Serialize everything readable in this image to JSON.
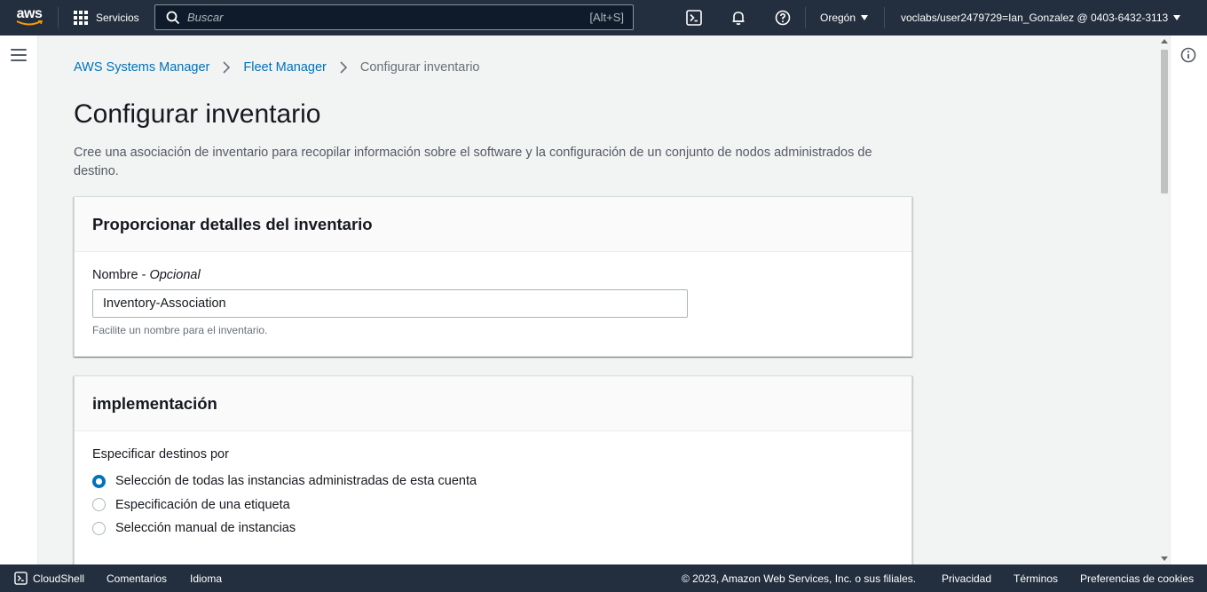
{
  "topnav": {
    "logo_text": "aws",
    "services_label": "Servicios",
    "search_placeholder": "Buscar",
    "search_shortcut": "[Alt+S]",
    "region": "Oregón",
    "account": "voclabs/user2479729=Ian_Gonzalez @ 0403-6432-3113"
  },
  "breadcrumb": {
    "items": [
      "AWS Systems Manager",
      "Fleet Manager"
    ],
    "current": "Configurar inventario"
  },
  "page": {
    "title": "Configurar inventario",
    "description": "Cree una asociación de inventario para recopilar información sobre el software y la configuración de un conjunto de nodos administrados de destino."
  },
  "inventory_panel": {
    "header": "Proporcionar detalles del inventario",
    "name_label": "Nombre - ",
    "name_optional": "Opcional",
    "name_value": "Inventory-Association",
    "name_hint": "Facilite un nombre para el inventario."
  },
  "deploy_panel": {
    "header": "implementación",
    "targets_label": "Especificar destinos por",
    "options": [
      {
        "label": "Selección de todas las instancias administradas de esta cuenta",
        "checked": true
      },
      {
        "label": "Especificación de una etiqueta",
        "checked": false
      },
      {
        "label": "Selección manual de instancias",
        "checked": false
      }
    ]
  },
  "footer": {
    "cloudshell": "CloudShell",
    "feedback": "Comentarios",
    "language": "Idioma",
    "copyright": "© 2023, Amazon Web Services, Inc. o sus filiales.",
    "privacy": "Privacidad",
    "terms": "Términos",
    "cookies": "Preferencias de cookies"
  },
  "colors": {
    "nav_bg": "#232f3e",
    "link": "#0073bb",
    "page_bg": "#f2f3f3"
  }
}
